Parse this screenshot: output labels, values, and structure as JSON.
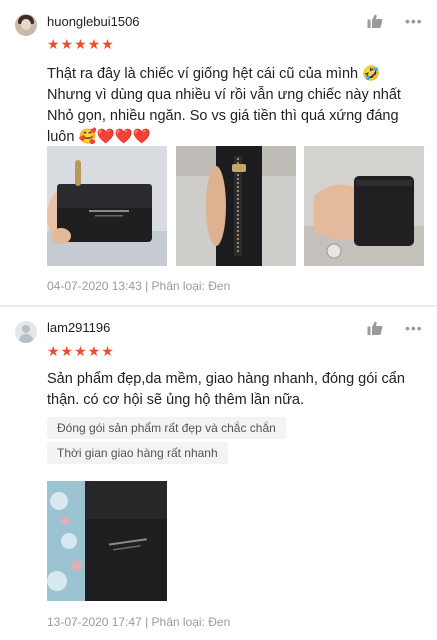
{
  "reviews": [
    {
      "username": "huonglebui1506",
      "stars": "★★★★★",
      "text": "Thật ra đây là chiếc ví giống hệt cái cũ của mình 🤣\nNhưng vì dùng qua nhiều ví rồi vẫn ưng chiếc này nhất\nNhỏ gọn, nhiều ngăn. So vs giá tiền thì quá xứng đáng luôn 🥰❤️❤️❤️",
      "photo_count": 3,
      "date": "04-07-2020 13:43",
      "variation_label": "Phân loại: Đen",
      "more_icon": "•••"
    },
    {
      "username": "lam291196",
      "stars": "★★★★★",
      "text": "Sản phẩm đẹp,da mềm, giao hàng nhanh, đóng gói cẩn thận. có cơ hội sẽ ủng hộ thêm lần nữa.",
      "tags": [
        "Đóng gói sản phẩm rất đẹp và chắc chắn",
        "Thời gian giao hàng rất nhanh"
      ],
      "photo_count": 1,
      "date": "13-07-2020 17:47",
      "variation_label": "Phân loại: Đen",
      "more_icon": "•••"
    }
  ],
  "icons": {
    "like": "thumbs-up-icon",
    "more": "more-dots-icon",
    "star": "star-icon"
  },
  "colors": {
    "star": "#ee4d2d",
    "meta_text": "#9b9b9b",
    "tag_bg": "#f3f3f3",
    "icon_gray": "#9a9a9a"
  }
}
